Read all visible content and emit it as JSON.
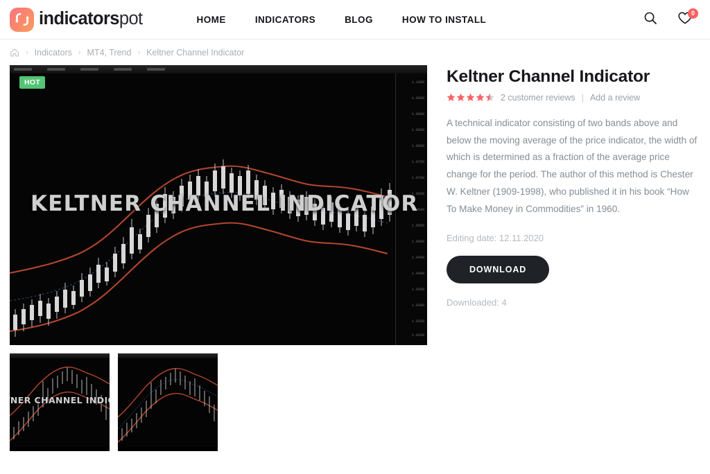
{
  "site": {
    "brand_strong": "indicators",
    "brand_light": "pot",
    "logo_icon": "updown-arrows-icon"
  },
  "header": {
    "nav": [
      {
        "label": "HOME",
        "name": "nav-home"
      },
      {
        "label": "INDICATORS",
        "name": "nav-indicators"
      },
      {
        "label": "BLOG",
        "name": "nav-blog"
      },
      {
        "label": "HOW TO INSTALL",
        "name": "nav-how-to-install"
      }
    ],
    "search_icon": "search-icon",
    "wishlist_icon": "heart-icon",
    "wishlist_count": "0"
  },
  "breadcrumb": {
    "home_icon": "home-icon",
    "separator": "›",
    "items": [
      {
        "label": "Indicators"
      },
      {
        "label": "MT4, Trend"
      },
      {
        "label": "Keltner Channel Indicator"
      }
    ]
  },
  "gallery": {
    "badge": "HOT",
    "main_image_caption": "KELTNER CHANNEL INDICATOR",
    "thumbnails": [
      {
        "caption": "TNER CHANNEL INDICA"
      },
      {
        "caption": ""
      }
    ],
    "price_axis_labels": [
      "1.1000",
      "1.0950",
      "1.0900",
      "1.0850",
      "1.0800",
      "1.0750",
      "1.0700",
      "1.0650",
      "1.0600",
      "1.0550",
      "1.0500",
      "1.0450",
      "1.0400",
      "1.0350",
      "1.0300",
      "1.0250",
      "1.0200"
    ]
  },
  "summary": {
    "title": "Keltner Channel Indicator",
    "rating_value": 4.5,
    "rating_max": 5,
    "reviews_label": "2 customer reviews",
    "separator": "|",
    "add_review_label": "Add a review",
    "description": "A technical indicator consisting of two bands above and below the moving average of the price indicator, the width of which is determined as a fraction of the average price change for the period. The author of this method is Chester W. Keltner (1909-1998), who published it in his book “How To Make Money in Commodities” in 1960.",
    "editing_date": "Editing date: 12.11.2020",
    "download_label": "DOWNLOAD",
    "downloaded": "Downloaded: 4"
  },
  "colors": {
    "accent_star": "#fb6161",
    "badge_hot": "#53c473",
    "wishlist_badge": "#fb6161",
    "button_dark": "#1f2227",
    "annotation_red": "#d81111",
    "brand_gradient_from": "#f9737f",
    "brand_gradient_to": "#fb9a5e"
  },
  "annotation": {
    "shape": "ellipse-highlight",
    "target": "download-button"
  }
}
